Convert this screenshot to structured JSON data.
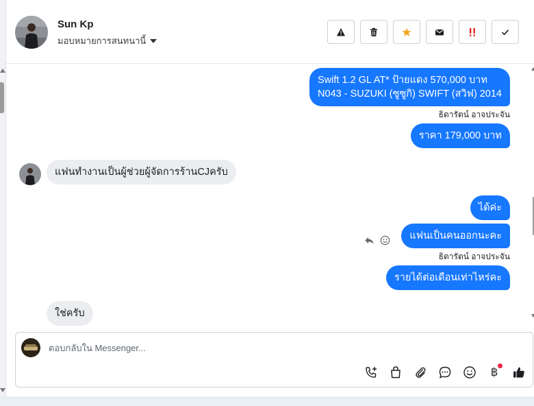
{
  "header": {
    "contact_name": "Sun Kp",
    "assign_label": "มอบหมายการสนทนานี้",
    "toolbar": [
      {
        "name": "spam-button",
        "icon": "warning-icon"
      },
      {
        "name": "delete-button",
        "icon": "trash-icon"
      },
      {
        "name": "star-button",
        "icon": "star-icon",
        "color": "#f5a623"
      },
      {
        "name": "mark-unread-button",
        "icon": "envelope-icon"
      },
      {
        "name": "follow-up-button",
        "icon": "urgent-icon",
        "color": "#e0261b"
      },
      {
        "name": "mark-done-button",
        "icon": "check-icon"
      }
    ]
  },
  "messages": [
    {
      "dir": "out",
      "lines": [
        "Swift 1.2 GL AT* ป้ายแดง 570,000 บาท",
        "N043 - SUZUKI (ซูซูกิ) SWIFT (สวิฟ) 2014"
      ],
      "sender": "ธิดารัตน์ อาจประจัน"
    },
    {
      "dir": "out",
      "text": "ราคา 179,000 บาท"
    },
    {
      "dir": "in",
      "text": "แฟนทำงานเป็นผู้ช่วยผู้จัดการร้านCJครับ"
    },
    {
      "dir": "out",
      "text": "ได้ค่ะ"
    },
    {
      "dir": "out",
      "text": "แฟนเป็นคนออกนะคะ",
      "sender": "ธิดารัตน์ อาจประจัน"
    },
    {
      "dir": "out",
      "text": "รายได้ต่อเดือนเท่าไหร่คะ"
    },
    {
      "dir": "in",
      "text": "ใช่ครับ"
    }
  ],
  "composer": {
    "placeholder": "ตอบกลับใน Messenger...",
    "icons": [
      "add-call-icon",
      "shopping-bag-icon",
      "paperclip-icon",
      "chat-bubble-icon",
      "emoji-icon",
      "baht-icon",
      "thumbs-up-icon"
    ],
    "baht_symbol": "฿",
    "notification_dot_color": "#f02849"
  },
  "colors": {
    "outgoing_bubble": "#1677ff",
    "incoming_bubble": "#ebedf0"
  }
}
